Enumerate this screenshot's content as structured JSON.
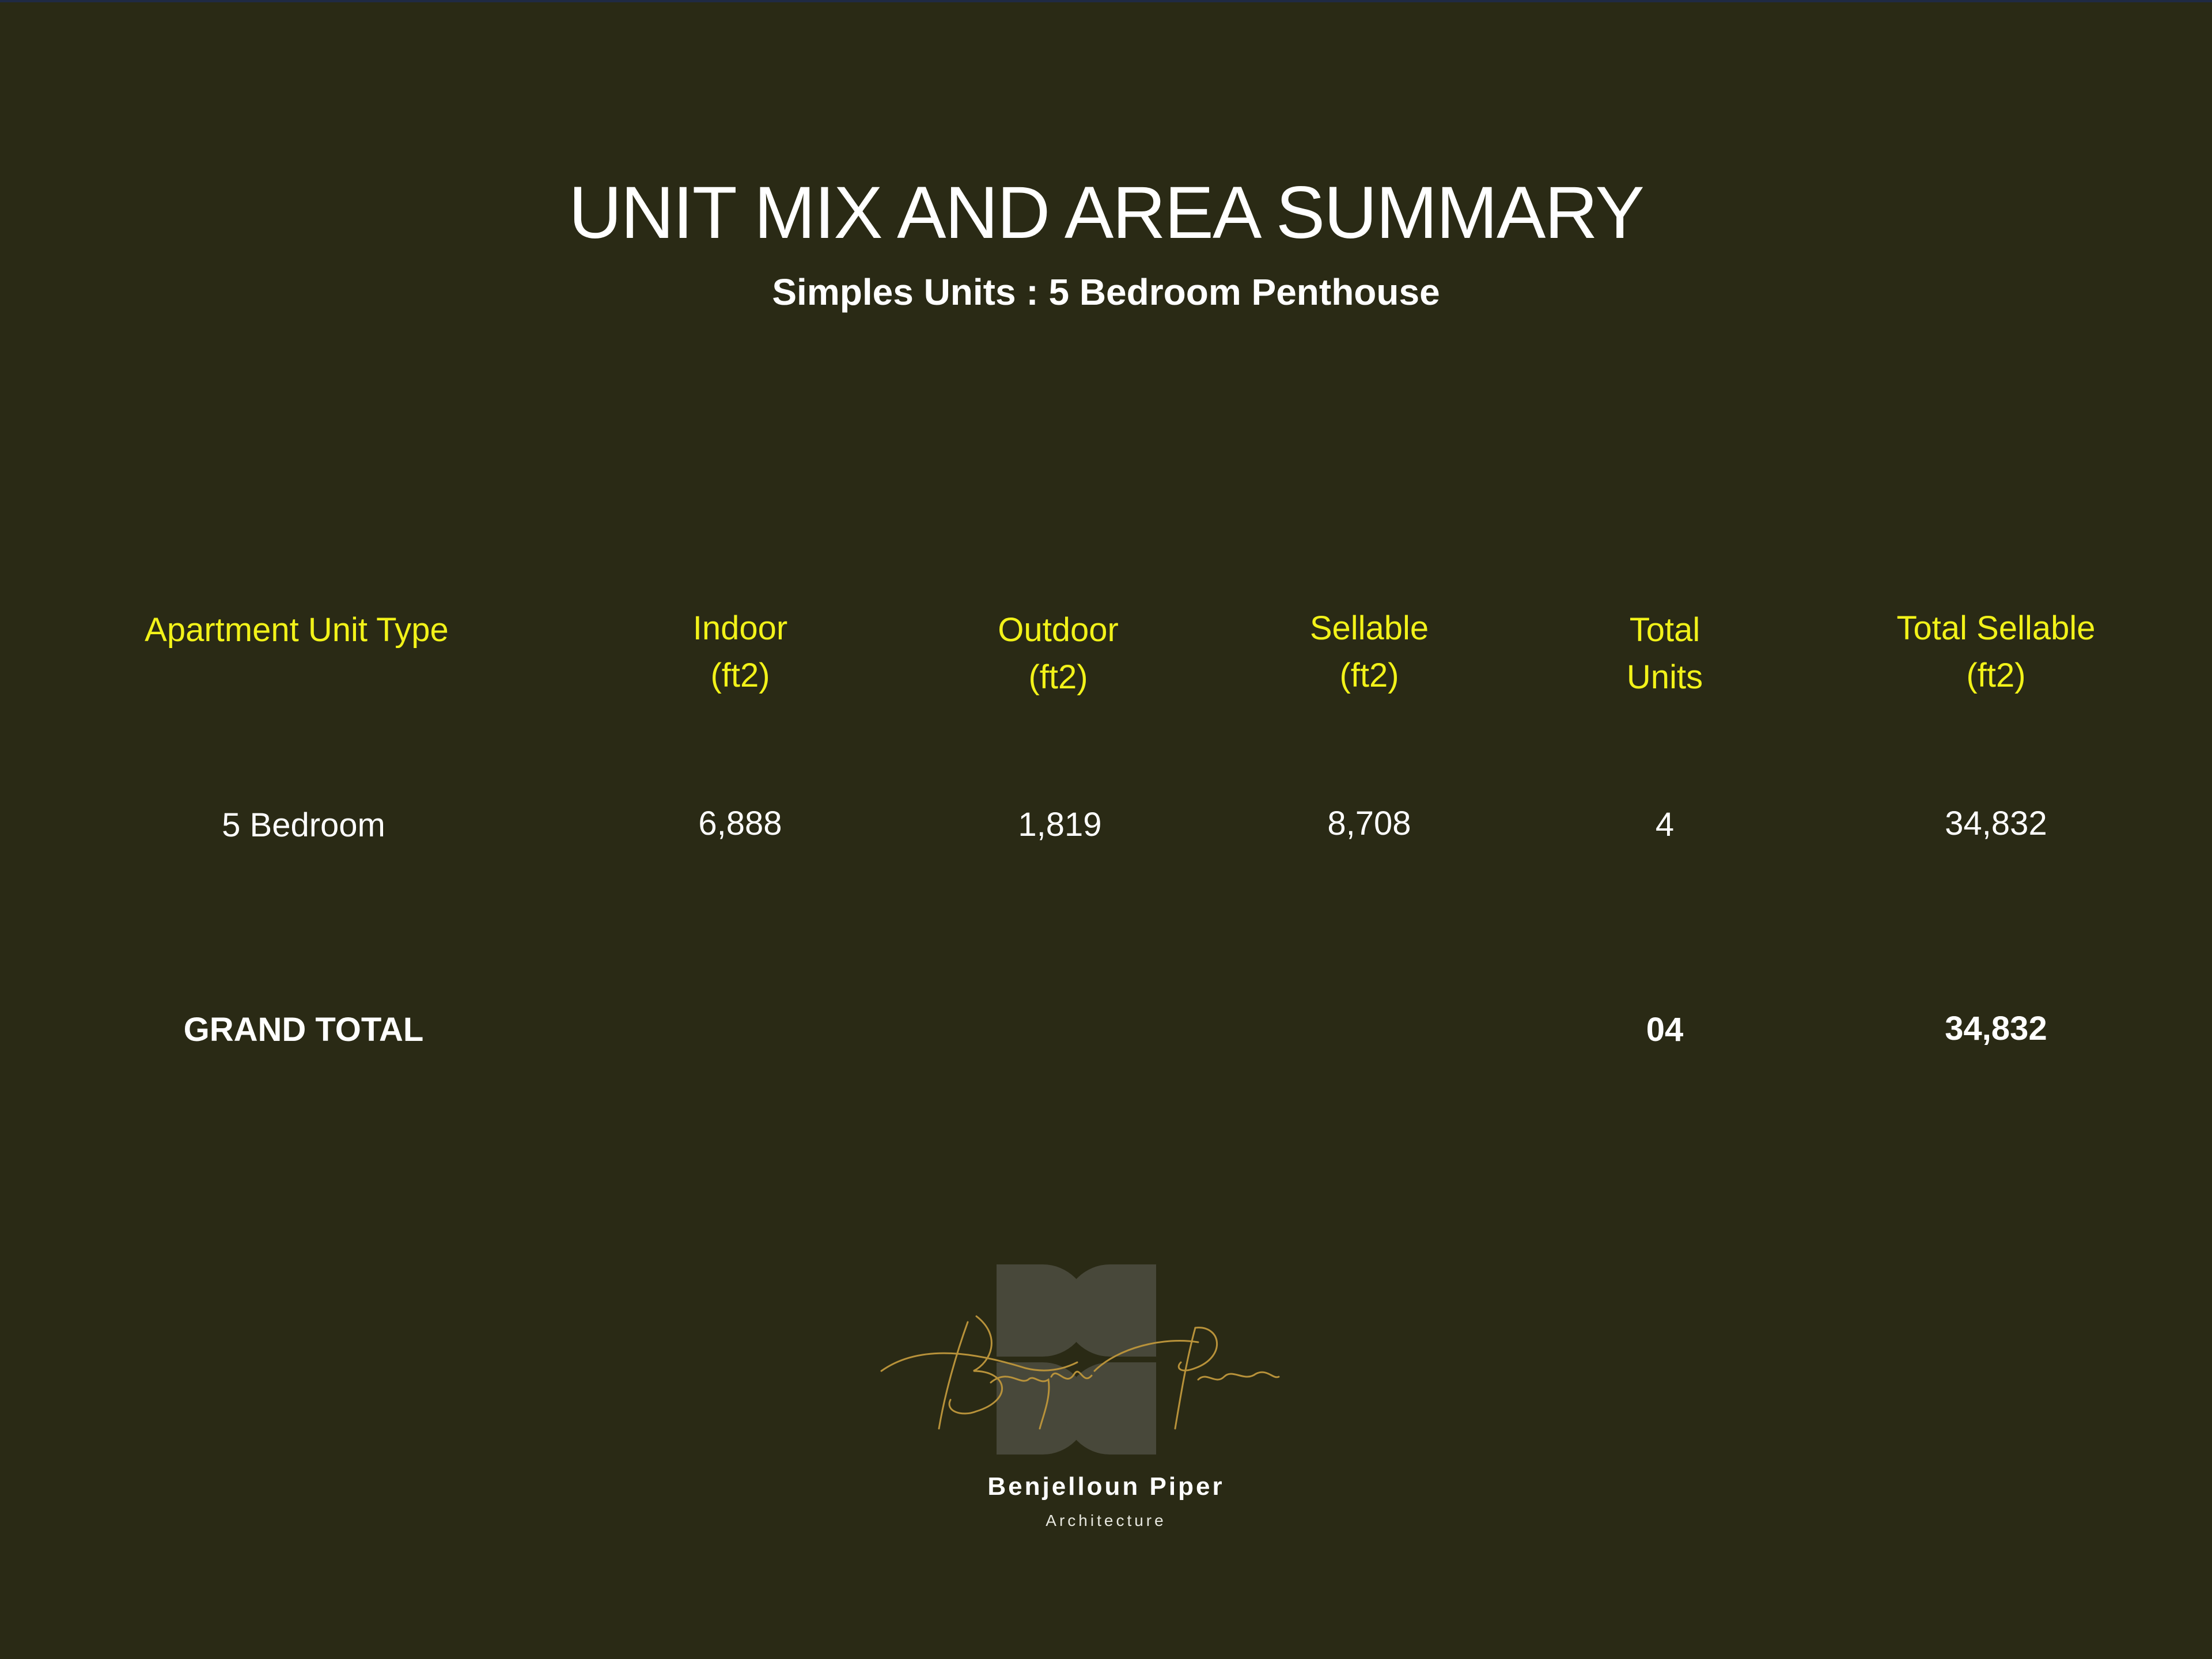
{
  "title": "UNIT MIX AND AREA SUMMARY",
  "subtitle": "Simples Units : 5 Bedroom Penthouse",
  "table": {
    "headers": [
      {
        "line1": "Apartment Unit Type",
        "line2": ""
      },
      {
        "line1": "Indoor",
        "line2": "(ft2)"
      },
      {
        "line1": "Outdoor",
        "line2": "(ft2)"
      },
      {
        "line1": "Sellable",
        "line2": "(ft2)"
      },
      {
        "line1": "Total",
        "line2": "Units"
      },
      {
        "line1": "Total Sellable",
        "line2": "(ft2)"
      }
    ],
    "rows": [
      [
        "5 Bedroom",
        "6,888",
        "1,819",
        "8,708",
        "4",
        "34,832"
      ]
    ],
    "grand_total": {
      "label": "GRAND TOTAL",
      "units": "04",
      "sellable": "34,832"
    }
  },
  "logo": {
    "signature": "Benjelloun Piper",
    "name": "Benjelloun Piper",
    "subtitle": "Architecture"
  },
  "colors": {
    "background": "#2a2a15",
    "header_text": "#f2f219",
    "body_text": "#ffffff",
    "signature_gold": "#b8923a"
  }
}
